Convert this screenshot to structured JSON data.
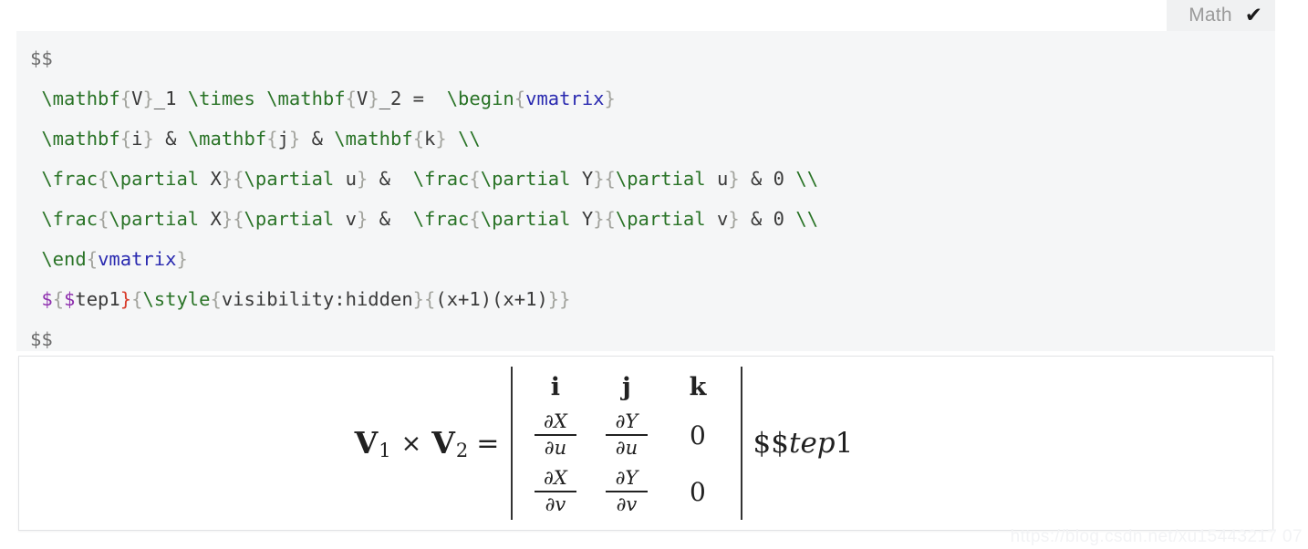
{
  "window": {
    "title": "Markdown Math Editor",
    "background": "#ffffff"
  },
  "colors": {
    "editor_background": "#f5f6f7",
    "preview_background": "#ffffff",
    "preview_border": "#e2e3e5",
    "tab_background": "#f0f1f2",
    "tab_label": "#9a9a9a",
    "token_command": "#297326",
    "token_brace": "#a3a49e",
    "token_brace_error": "#d83b2a",
    "token_environment": "#2a2ab0",
    "token_dollar": "#8e2fae",
    "token_text": "#3a3a3a",
    "token_delimiter": "#6b6b6b",
    "math_text": "#212121",
    "watermark": "#f2f3f5"
  },
  "tabbar": {
    "math_tab_label": "Math",
    "math_tab_check": "✔",
    "check_icon_name": "checkmark-icon"
  },
  "editor": {
    "language": "latex",
    "raw_source": "$$\n\\mathbf{V}_1 \\times \\mathbf{V}_2 =  \\begin{vmatrix}\n\\mathbf{i} & \\mathbf{j} & \\mathbf{k} \\\\\n\\frac{\\partial X}{\\partial u} &  \\frac{\\partial Y}{\\partial u} & 0 \\\\\n\\frac{\\partial X}{\\partial v} &  \\frac{\\partial Y}{\\partial v} & 0 \\\\\n\\end{vmatrix}\n${$tep1}{\\style{visibility:hidden}{(x+1)(x+1)}}\n$$",
    "lines": [
      {
        "n": 1,
        "tokens": [
          {
            "t": "$$",
            "c": "delim"
          }
        ]
      },
      {
        "n": 2,
        "tokens": [
          {
            "t": " ",
            "c": "txt"
          },
          {
            "t": "\\mathbf",
            "c": "cmd"
          },
          {
            "t": "{",
            "c": "brace"
          },
          {
            "t": "V",
            "c": "txt"
          },
          {
            "t": "}",
            "c": "brace"
          },
          {
            "t": "_1 ",
            "c": "txt"
          },
          {
            "t": "\\times",
            "c": "cmd"
          },
          {
            "t": " ",
            "c": "txt"
          },
          {
            "t": "\\mathbf",
            "c": "cmd"
          },
          {
            "t": "{",
            "c": "brace"
          },
          {
            "t": "V",
            "c": "txt"
          },
          {
            "t": "}",
            "c": "brace"
          },
          {
            "t": "_2 =  ",
            "c": "txt"
          },
          {
            "t": "\\begin",
            "c": "cmd"
          },
          {
            "t": "{",
            "c": "brace"
          },
          {
            "t": "vmatrix",
            "c": "env"
          },
          {
            "t": "}",
            "c": "brace"
          }
        ]
      },
      {
        "n": 3,
        "tokens": [
          {
            "t": " ",
            "c": "txt"
          },
          {
            "t": "\\mathbf",
            "c": "cmd"
          },
          {
            "t": "{",
            "c": "brace"
          },
          {
            "t": "i",
            "c": "txt"
          },
          {
            "t": "}",
            "c": "brace"
          },
          {
            "t": " & ",
            "c": "amp"
          },
          {
            "t": "\\mathbf",
            "c": "cmd"
          },
          {
            "t": "{",
            "c": "brace"
          },
          {
            "t": "j",
            "c": "txt"
          },
          {
            "t": "}",
            "c": "brace"
          },
          {
            "t": " & ",
            "c": "amp"
          },
          {
            "t": "\\mathbf",
            "c": "cmd"
          },
          {
            "t": "{",
            "c": "brace"
          },
          {
            "t": "k",
            "c": "txt"
          },
          {
            "t": "}",
            "c": "brace"
          },
          {
            "t": " ",
            "c": "txt"
          },
          {
            "t": "\\\\",
            "c": "cmd"
          }
        ]
      },
      {
        "n": 4,
        "tokens": [
          {
            "t": " ",
            "c": "txt"
          },
          {
            "t": "\\frac",
            "c": "cmd"
          },
          {
            "t": "{",
            "c": "brace"
          },
          {
            "t": "\\partial",
            "c": "cmd"
          },
          {
            "t": " X",
            "c": "txt"
          },
          {
            "t": "}",
            "c": "brace"
          },
          {
            "t": "{",
            "c": "brace"
          },
          {
            "t": "\\partial",
            "c": "cmd"
          },
          {
            "t": " u",
            "c": "txt"
          },
          {
            "t": "}",
            "c": "brace"
          },
          {
            "t": " & ",
            "c": "amp"
          },
          {
            "t": " ",
            "c": "txt"
          },
          {
            "t": "\\frac",
            "c": "cmd"
          },
          {
            "t": "{",
            "c": "brace"
          },
          {
            "t": "\\partial",
            "c": "cmd"
          },
          {
            "t": " Y",
            "c": "txt"
          },
          {
            "t": "}",
            "c": "brace"
          },
          {
            "t": "{",
            "c": "brace"
          },
          {
            "t": "\\partial",
            "c": "cmd"
          },
          {
            "t": " u",
            "c": "txt"
          },
          {
            "t": "}",
            "c": "brace"
          },
          {
            "t": " & 0 ",
            "c": "amp"
          },
          {
            "t": "\\\\",
            "c": "cmd"
          }
        ]
      },
      {
        "n": 5,
        "tokens": [
          {
            "t": " ",
            "c": "txt"
          },
          {
            "t": "\\frac",
            "c": "cmd"
          },
          {
            "t": "{",
            "c": "brace"
          },
          {
            "t": "\\partial",
            "c": "cmd"
          },
          {
            "t": " X",
            "c": "txt"
          },
          {
            "t": "}",
            "c": "brace"
          },
          {
            "t": "{",
            "c": "brace"
          },
          {
            "t": "\\partial",
            "c": "cmd"
          },
          {
            "t": " v",
            "c": "txt"
          },
          {
            "t": "}",
            "c": "brace"
          },
          {
            "t": " & ",
            "c": "amp"
          },
          {
            "t": " ",
            "c": "txt"
          },
          {
            "t": "\\frac",
            "c": "cmd"
          },
          {
            "t": "{",
            "c": "brace"
          },
          {
            "t": "\\partial",
            "c": "cmd"
          },
          {
            "t": " Y",
            "c": "txt"
          },
          {
            "t": "}",
            "c": "brace"
          },
          {
            "t": "{",
            "c": "brace"
          },
          {
            "t": "\\partial",
            "c": "cmd"
          },
          {
            "t": " v",
            "c": "txt"
          },
          {
            "t": "}",
            "c": "brace"
          },
          {
            "t": " & 0 ",
            "c": "amp"
          },
          {
            "t": "\\\\",
            "c": "cmd"
          }
        ]
      },
      {
        "n": 6,
        "tokens": [
          {
            "t": " ",
            "c": "txt"
          },
          {
            "t": "\\end",
            "c": "cmd"
          },
          {
            "t": "{",
            "c": "brace"
          },
          {
            "t": "vmatrix",
            "c": "env"
          },
          {
            "t": "}",
            "c": "brace"
          }
        ]
      },
      {
        "n": 7,
        "tokens": [
          {
            "t": " ",
            "c": "txt"
          },
          {
            "t": "$",
            "c": "dollar"
          },
          {
            "t": "{",
            "c": "brace"
          },
          {
            "t": "$",
            "c": "dollar"
          },
          {
            "t": "tep1",
            "c": "txt"
          },
          {
            "t": "}",
            "c": "brace-err"
          },
          {
            "t": "{",
            "c": "brace"
          },
          {
            "t": "\\style",
            "c": "cmd"
          },
          {
            "t": "{",
            "c": "brace"
          },
          {
            "t": "visibility:hidden",
            "c": "txt"
          },
          {
            "t": "}",
            "c": "brace"
          },
          {
            "t": "{",
            "c": "brace"
          },
          {
            "t": "(x+1)(x+1)",
            "c": "txt"
          },
          {
            "t": "}",
            "c": "brace"
          },
          {
            "t": "}",
            "c": "brace"
          }
        ]
      },
      {
        "n": 8,
        "tokens": [
          {
            "t": "$$",
            "c": "delim"
          }
        ]
      }
    ]
  },
  "preview": {
    "lhs": {
      "v1_base": "V",
      "v1_sub": "1",
      "cross_operator": "×",
      "v2_base": "V",
      "v2_sub": "2",
      "equals": "="
    },
    "determinant": {
      "left_bar": "|",
      "right_bar": "|",
      "rows": [
        {
          "cells": [
            {
              "kind": "unit",
              "text": "i"
            },
            {
              "kind": "unit",
              "text": "j"
            },
            {
              "kind": "unit",
              "text": "k"
            }
          ]
        },
        {
          "cells": [
            {
              "kind": "frac",
              "num_partial": "∂",
              "num_var": "X",
              "den_partial": "∂",
              "den_var": "u"
            },
            {
              "kind": "frac",
              "num_partial": "∂",
              "num_var": "Y",
              "den_partial": "∂",
              "den_var": "u"
            },
            {
              "kind": "zero",
              "text": "0"
            }
          ]
        },
        {
          "cells": [
            {
              "kind": "frac",
              "num_partial": "∂",
              "num_var": "X",
              "den_partial": "∂",
              "den_var": "v"
            },
            {
              "kind": "frac",
              "num_partial": "∂",
              "num_var": "Y",
              "den_partial": "∂",
              "den_var": "v"
            },
            {
              "kind": "zero",
              "text": "0"
            }
          ]
        }
      ]
    },
    "trailing_text": {
      "literal": "$$",
      "italic": "tep",
      "upright": "1"
    }
  },
  "watermark": {
    "text": "https://blog.csdn.net/xu15443217 07"
  }
}
